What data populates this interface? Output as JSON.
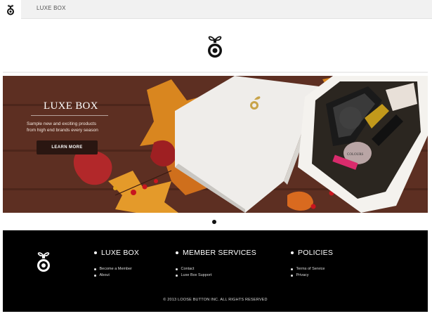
{
  "topbar": {
    "brand": "LUXE BOX"
  },
  "hero": {
    "title": "LUXE BOX",
    "subtitle_line1": "Sample new and exciting products",
    "subtitle_line2": "from high end brands every season",
    "cta_label": "LEARN MORE",
    "box_label": "COLOURS"
  },
  "footer": {
    "columns": [
      {
        "title": "LUXE BOX",
        "links": [
          "Become a Member",
          "About"
        ]
      },
      {
        "title": "MEMBER SERVICES",
        "links": [
          "Contact",
          "Luxe Box Support"
        ]
      },
      {
        "title": "POLICIES",
        "links": [
          "Terms of Service",
          "Privacy"
        ]
      }
    ],
    "copyright": "© 2013 LOOSE BUTTON INC. ALL RIGHTS RESERVED"
  },
  "colors": {
    "accent": "#000000",
    "hero_button": "#2a1611",
    "gold": "#c8a44a"
  },
  "icons": {
    "logo": "ornament-bow-icon"
  }
}
